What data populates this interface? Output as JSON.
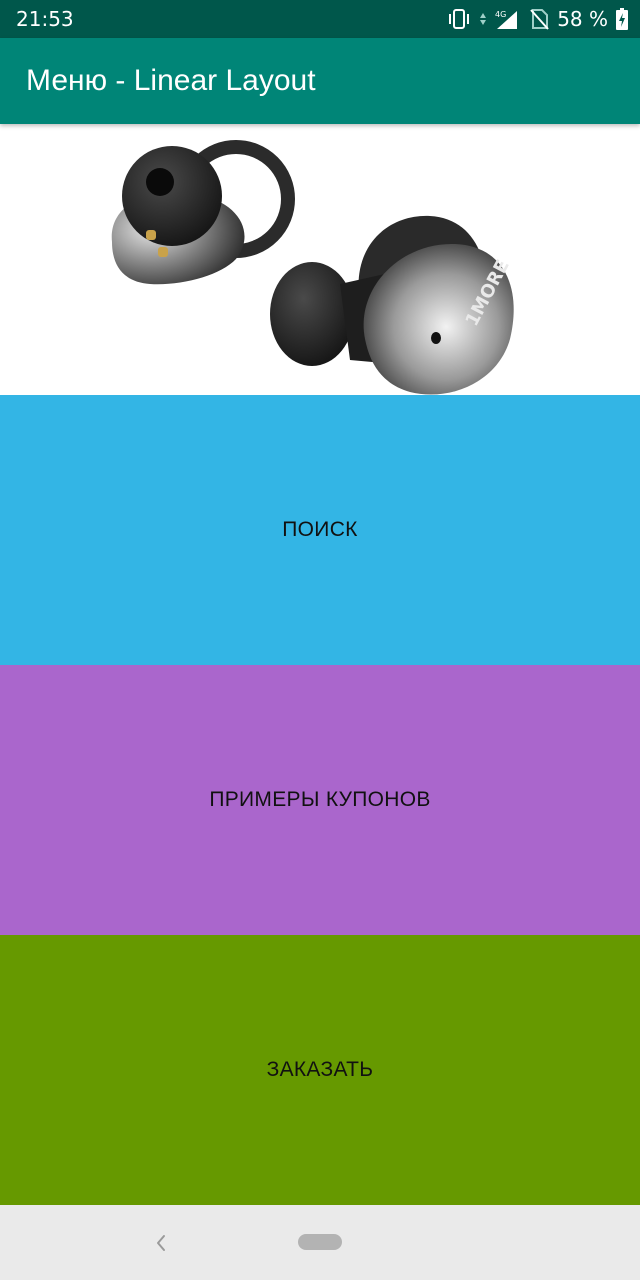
{
  "status_bar": {
    "time": "21:53",
    "network_label": "4G",
    "battery_text": "58 %",
    "background_color": "#00574b"
  },
  "app_bar": {
    "title": "Меню - Linear Layout",
    "background_color": "#008577"
  },
  "hero": {
    "image_icon": "earbuds-image",
    "brand_text": "1MORE"
  },
  "menu": {
    "search_label": "ПОИСК",
    "search_color": "#33b5e5",
    "coupons_label": "ПРИМЕРЫ КУПОНОВ",
    "coupons_color": "#aa66cc",
    "order_label": "ЗАКАЗАТЬ",
    "order_color": "#669900"
  },
  "nav_bar": {
    "back_icon": "chevron-left-icon",
    "home_icon": "home-pill-icon"
  }
}
